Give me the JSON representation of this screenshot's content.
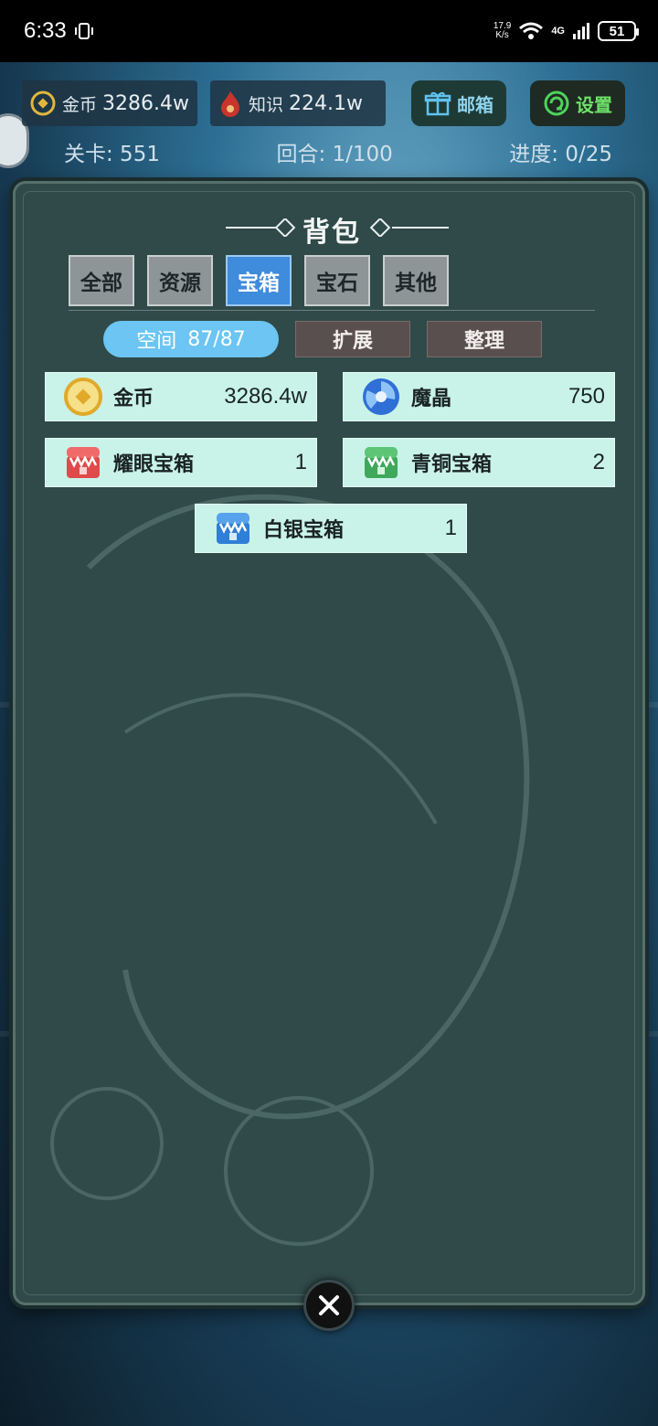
{
  "status_bar": {
    "time": "6:33",
    "net_speed_value": "17.9",
    "net_speed_unit": "K/s",
    "network": "4G",
    "battery": "51"
  },
  "hud": {
    "gold_label": "金币",
    "gold_value": "3286.4w",
    "knowledge_label": "知识",
    "knowledge_value": "224.1w",
    "mailbox_label": "邮箱",
    "settings_label": "设置",
    "level_text": "关卡: 551",
    "round_text": "回合: 1/100",
    "progress_text": "进度: 0/25"
  },
  "panel": {
    "title": "背包",
    "tabs": [
      "全部",
      "资源",
      "宝箱",
      "宝石",
      "其他"
    ],
    "active_tab": 2,
    "space_label": "空间",
    "space_value": "87/87",
    "expand_label": "扩展",
    "sort_label": "整理",
    "items": [
      {
        "name": "金币",
        "qty": "3286.4w",
        "icon": "gold-coin-icon"
      },
      {
        "name": "魔晶",
        "qty": "750",
        "icon": "magic-crystal-icon"
      },
      {
        "name": "耀眼宝箱",
        "qty": "1",
        "icon": "red-chest-icon"
      },
      {
        "name": "青铜宝箱",
        "qty": "2",
        "icon": "green-chest-icon"
      },
      {
        "name": "白银宝箱",
        "qty": "1",
        "icon": "blue-chest-icon"
      }
    ]
  },
  "colors": {
    "active_tab": "#3f8bdc",
    "item_bg": "#c9f3e9",
    "space_pill": "#6cc5f2"
  }
}
